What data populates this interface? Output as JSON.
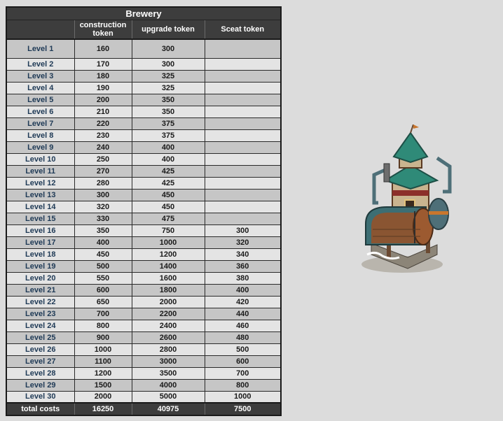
{
  "title": "Brewery",
  "headers": [
    "",
    "construction token",
    "upgrade token",
    "Sceat token"
  ],
  "rows": [
    {
      "level": "Level 1",
      "construction": "160",
      "upgrade": "300",
      "sceat": ""
    },
    {
      "level": "Level 2",
      "construction": "170",
      "upgrade": "300",
      "sceat": ""
    },
    {
      "level": "Level 3",
      "construction": "180",
      "upgrade": "325",
      "sceat": ""
    },
    {
      "level": "Level 4",
      "construction": "190",
      "upgrade": "325",
      "sceat": ""
    },
    {
      "level": "Level 5",
      "construction": "200",
      "upgrade": "350",
      "sceat": ""
    },
    {
      "level": "Level 6",
      "construction": "210",
      "upgrade": "350",
      "sceat": ""
    },
    {
      "level": "Level 7",
      "construction": "220",
      "upgrade": "375",
      "sceat": ""
    },
    {
      "level": "Level 8",
      "construction": "230",
      "upgrade": "375",
      "sceat": ""
    },
    {
      "level": "Level 9",
      "construction": "240",
      "upgrade": "400",
      "sceat": ""
    },
    {
      "level": "Level 10",
      "construction": "250",
      "upgrade": "400",
      "sceat": ""
    },
    {
      "level": "Level 11",
      "construction": "270",
      "upgrade": "425",
      "sceat": ""
    },
    {
      "level": "Level 12",
      "construction": "280",
      "upgrade": "425",
      "sceat": ""
    },
    {
      "level": "Level 13",
      "construction": "300",
      "upgrade": "450",
      "sceat": ""
    },
    {
      "level": "Level 14",
      "construction": "320",
      "upgrade": "450",
      "sceat": ""
    },
    {
      "level": "Level 15",
      "construction": "330",
      "upgrade": "475",
      "sceat": ""
    },
    {
      "level": "Level 16",
      "construction": "350",
      "upgrade": "750",
      "sceat": "300"
    },
    {
      "level": "Level 17",
      "construction": "400",
      "upgrade": "1000",
      "sceat": "320"
    },
    {
      "level": "Level 18",
      "construction": "450",
      "upgrade": "1200",
      "sceat": "340"
    },
    {
      "level": "Level 19",
      "construction": "500",
      "upgrade": "1400",
      "sceat": "360"
    },
    {
      "level": "Level 20",
      "construction": "550",
      "upgrade": "1600",
      "sceat": "380"
    },
    {
      "level": "Level 21",
      "construction": "600",
      "upgrade": "1800",
      "sceat": "400"
    },
    {
      "level": "Level 22",
      "construction": "650",
      "upgrade": "2000",
      "sceat": "420"
    },
    {
      "level": "Level 23",
      "construction": "700",
      "upgrade": "2200",
      "sceat": "440"
    },
    {
      "level": "Level 24",
      "construction": "800",
      "upgrade": "2400",
      "sceat": "460"
    },
    {
      "level": "Level 25",
      "construction": "900",
      "upgrade": "2600",
      "sceat": "480"
    },
    {
      "level": "Level 26",
      "construction": "1000",
      "upgrade": "2800",
      "sceat": "500"
    },
    {
      "level": "Level 27",
      "construction": "1100",
      "upgrade": "3000",
      "sceat": "600"
    },
    {
      "level": "Level 28",
      "construction": "1200",
      "upgrade": "3500",
      "sceat": "700"
    },
    {
      "level": "Level 29",
      "construction": "1500",
      "upgrade": "4000",
      "sceat": "800"
    },
    {
      "level": "Level 30",
      "construction": "2000",
      "upgrade": "5000",
      "sceat": "1000"
    }
  ],
  "totals": {
    "label": "total costs",
    "construction": "16250",
    "upgrade": "40975",
    "sceat": "7500"
  },
  "image": {
    "icon": "brewery-building-icon"
  },
  "colors": {
    "header_bg": "#3d3d3d",
    "row_dark": "#c6c6c6",
    "row_light": "#e4e4e4",
    "level_text": "#1f3a56",
    "roof": "#2f8a78"
  }
}
